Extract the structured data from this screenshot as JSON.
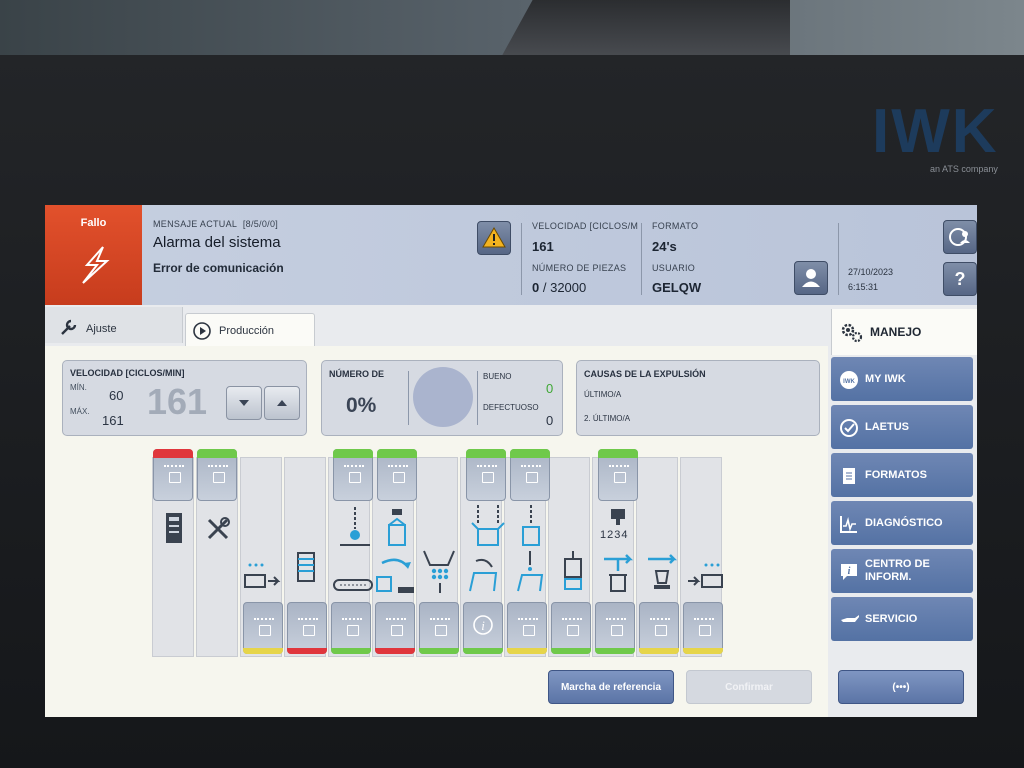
{
  "brand": {
    "logo": "IWK",
    "sub": "an ATS company"
  },
  "header": {
    "fault_label": "Fallo",
    "message_label": "MENSAJE ACTUAL",
    "message_code": "[8/5/0/0]",
    "alarm_title": "Alarma del sistema",
    "alarm_detail": "Error de comunicación",
    "speed_label": "VELOCIDAD [CICLOS/M",
    "speed_value": "161",
    "pieces_label": "NÚMERO DE PIEZAS",
    "pieces_current": "0",
    "pieces_total": "/ 32000",
    "format_label": "FORMATO",
    "format_value": "24's",
    "user_label": "USUARIO",
    "user_value": "GELQW",
    "date": "27/10/2023",
    "time": "6:15:31",
    "help_label": "?"
  },
  "tabs": [
    {
      "label": "Ajuste",
      "icon": "wrench-icon"
    },
    {
      "label": "Producción",
      "icon": "play-circle-icon",
      "active": true
    }
  ],
  "speed_card": {
    "title": "VELOCIDAD [CICLOS/MIN]",
    "min_label": "MÍN.",
    "min_value": "60",
    "max_label": "MÁX.",
    "max_value": "161",
    "current": "161"
  },
  "count_card": {
    "title": "NÚMERO DE",
    "percent": "0%",
    "good_label": "BUENO",
    "good_value": "0",
    "bad_label": "DEFECTUOSO",
    "bad_value": "0"
  },
  "eject_card": {
    "title": "CAUSAS DE LA EXPULSIÓN",
    "last_label": "ÚLTIMO/A",
    "second_label": "2. ÚLTIMO/A"
  },
  "station_code": "1234",
  "sidebar": {
    "header": "MANEJO",
    "items": [
      {
        "label": "MY IWK",
        "icon": "iwk-badge-icon"
      },
      {
        "label": "LAETUS",
        "icon": "check-circle-icon"
      },
      {
        "label": "FORMATOS",
        "icon": "document-icon"
      },
      {
        "label": "DIAGNÓSTICO",
        "icon": "pulse-chart-icon"
      },
      {
        "label": "CENTRO DE\nINFORM.",
        "icon": "info-icon"
      },
      {
        "label": "SERVICIO",
        "icon": "oil-can-icon"
      }
    ]
  },
  "buttons": {
    "reference": "Marcha de referencia",
    "confirm": "Confirmar",
    "more": "(•••)"
  },
  "colors": {
    "fault": "#d8482a",
    "accent": "#5a76a8",
    "green": "#6fc94a",
    "red": "#e0363c",
    "yellow": "#e6d54a",
    "cyan": "#2a9fd6"
  }
}
